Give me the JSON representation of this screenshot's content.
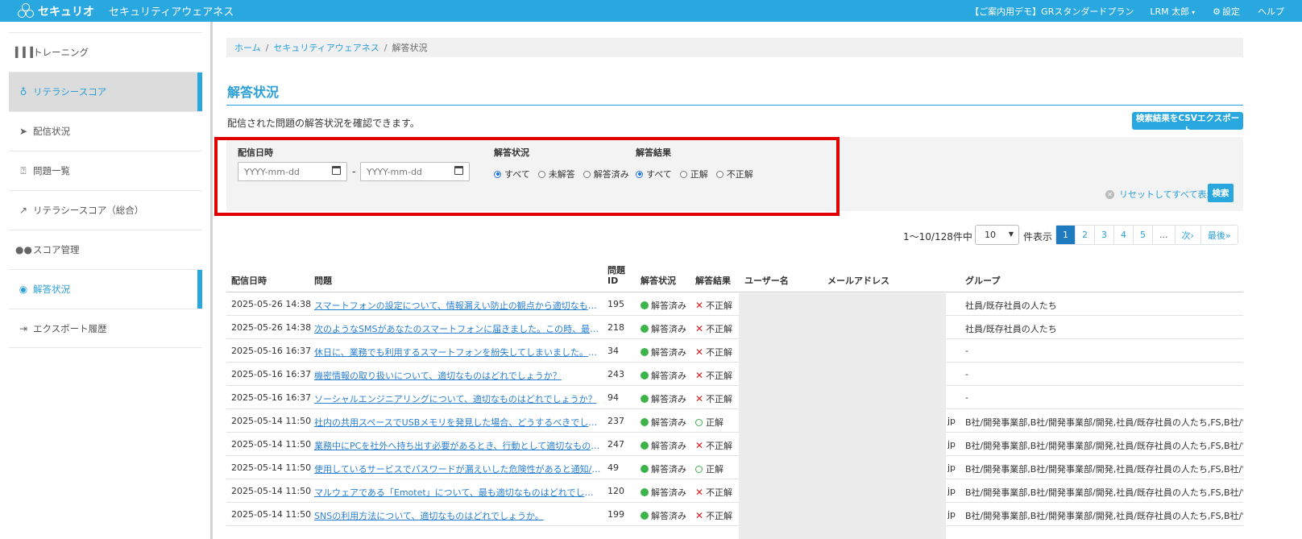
{
  "topbar": {
    "brand": "セキュリオ",
    "app_title": "セキュリティアウェアネス",
    "plan": "【ご案内用デモ】GRスタンダードプラン",
    "user": "LRM 太郎",
    "settings": "設定",
    "help": "ヘルプ"
  },
  "sidebar": {
    "items": [
      {
        "label": "トレーニング",
        "icon": "dumbbell-icon"
      },
      {
        "label": "リテラシースコア",
        "icon": "medal-icon"
      },
      {
        "label": "配信状況",
        "icon": "paper-plane-icon"
      },
      {
        "label": "問題一覧",
        "icon": "question-square-icon"
      },
      {
        "label": "リテラシースコア（総合）",
        "icon": "line-chart-icon"
      },
      {
        "label": "スコア管理",
        "icon": "users-icon"
      },
      {
        "label": "解答状況",
        "icon": "chat-users-icon"
      },
      {
        "label": "エクスポート履歴",
        "icon": "file-export-icon"
      }
    ]
  },
  "breadcrumb": {
    "home": "ホーム",
    "section": "セキュリティアウェアネス",
    "current": "解答状況",
    "sep": "/"
  },
  "page": {
    "title": "解答状況",
    "description": "配信された問題の解答状況を確認できます。",
    "csv_button": "検索結果をCSVエクスポート"
  },
  "filter": {
    "date_label": "配信日時",
    "date_from_placeholder": "YYYY-mm-dd",
    "date_to_placeholder": "YYYY-mm-dd",
    "date_sep": "-",
    "status_label": "解答状況",
    "status_options": [
      "すべて",
      "未解答",
      "解答済み"
    ],
    "result_label": "解答結果",
    "result_options": [
      "すべて",
      "正解",
      "不正解"
    ],
    "reset_label": "リセットしてすべて表示",
    "search_button": "検索"
  },
  "pagination": {
    "count_text": "1〜10/128件中",
    "per_page": "10",
    "per_page_label": "件表示",
    "pages": [
      "1",
      "2",
      "3",
      "4",
      "5",
      "...",
      "次›",
      "最後»"
    ],
    "current": "1"
  },
  "table": {
    "headers": {
      "date": "配信日時",
      "question": "問題",
      "qid": "問題ID",
      "status": "解答状況",
      "result": "解答結果",
      "user": "ユーザー名",
      "email": "メールアドレス",
      "group": "グループ"
    },
    "rows": [
      {
        "date": "2025-05-26 14:38",
        "question": "スマートフォンの設定について、情報漏えい防止の観点から適切なものはどれで…",
        "qid": "195",
        "status": "解答済み",
        "result": "不正解",
        "email_suffix": "",
        "group": "社員/既存社員の人たち"
      },
      {
        "date": "2025-05-26 14:38",
        "question": "次のようなSMSがあなたのスマートフォンに届きました。この時、最も安全な…",
        "qid": "218",
        "status": "解答済み",
        "result": "不正解",
        "email_suffix": "",
        "group": "社員/既存社員の人たち"
      },
      {
        "date": "2025-05-16 16:37",
        "question": "休日に、業務でも利用するスマートフォンを紛失してしまいました。そのときの…",
        "qid": "34",
        "status": "解答済み",
        "result": "不正解",
        "email_suffix": "",
        "group": "-"
      },
      {
        "date": "2025-05-16 16:37",
        "question": "機密情報の取り扱いについて、適切なものはどれでしょうか？",
        "qid": "243",
        "status": "解答済み",
        "result": "不正解",
        "email_suffix": "",
        "group": "-"
      },
      {
        "date": "2025-05-16 16:37",
        "question": "ソーシャルエンジニアリングについて、適切なものはどれでしょうか？",
        "qid": "94",
        "status": "解答済み",
        "result": "不正解",
        "email_suffix": "",
        "group": "-"
      },
      {
        "date": "2025-05-14 11:50",
        "question": "社内の共用スペースでUSBメモリを発見した場合、どうするべきでしょうか？",
        "qid": "237",
        "status": "解答済み",
        "result": "正解",
        "email_suffix": "jp",
        "group": "B社/開発事業部,B社/開発事業部/開発,社員/既存社員の人たち,FS,B社/営業部"
      },
      {
        "date": "2025-05-14 11:50",
        "question": "業務中にPCを社外へ持ち出す必要があるとき、行動として適切なものはどれで…",
        "qid": "247",
        "status": "解答済み",
        "result": "不正解",
        "email_suffix": "jp",
        "group": "B社/開発事業部,B社/開発事業部/開発,社員/既存社員の人たち,FS,B社/営業部"
      },
      {
        "date": "2025-05-14 11:50",
        "question": "使用しているサービスでパスワードが漏えいした危険性があると通知/メールが…",
        "qid": "49",
        "status": "解答済み",
        "result": "正解",
        "email_suffix": "jp",
        "group": "B社/開発事業部,B社/開発事業部/開発,社員/既存社員の人たち,FS,B社/営業部"
      },
      {
        "date": "2025-05-14 11:50",
        "question": "マルウェアである「Emotet」について、最も適切なものはどれでしょうか…",
        "qid": "120",
        "status": "解答済み",
        "result": "不正解",
        "email_suffix": "jp",
        "group": "B社/開発事業部,B社/開発事業部/開発,社員/既存社員の人たち,FS,B社/営業部"
      },
      {
        "date": "2025-05-14 11:50",
        "question": "SNSの利用方法について、適切なものはどれでしょうか。",
        "qid": "199",
        "status": "解答済み",
        "result": "不正解",
        "email_suffix": "jp",
        "group": "B社/開発事業部,B社/開発事業部/開発,社員/既存社員の人たち,FS,B社/営業部"
      }
    ]
  }
}
